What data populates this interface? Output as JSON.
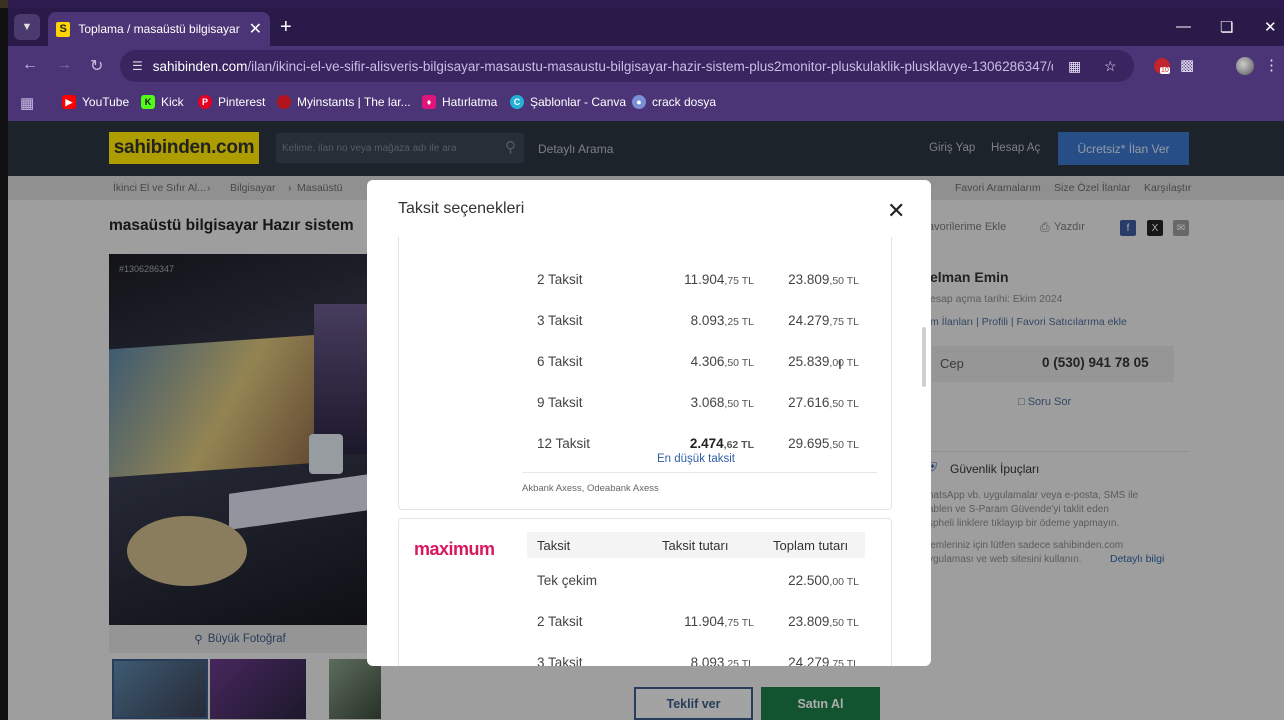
{
  "browser": {
    "tab_title": "Toplama / masaüstü bilgisayar",
    "url_host": "sahibinden.com",
    "url_path": "/ilan/ikinci-el-ve-sifir-alisveris-bilgisayar-masaustu-masaustu-bilgisayar-hazir-sistem-plus2monitor-pluskulaklik-plusklavye-1306286347/de...",
    "bookmarks": [
      {
        "label": "YouTube",
        "color": "#ff0000"
      },
      {
        "label": "Kick",
        "color": "#53fc18"
      },
      {
        "label": "Pinterest",
        "color": "#e60023"
      },
      {
        "label": "Myinstants | The lar...",
        "color": "#b0131c"
      },
      {
        "label": "Hatırlatma",
        "color": "#e0157a"
      },
      {
        "label": "Şablonlar - Canva",
        "color": "#22b1d6"
      },
      {
        "label": "crack dosya",
        "color": "#7a8fd6"
      }
    ],
    "ext_badge": "10"
  },
  "site": {
    "logo": "sahibinden.com",
    "search_placeholder": "Kelime, ilan no veya mağaza adı ile ara",
    "detailed_search": "Detaylı Arama",
    "login": "Giriş Yap",
    "register": "Hesap Aç",
    "post_ad": "Ücretsiz* İlan Ver",
    "breadcrumbs": [
      "İkinci El ve Sıfır Al...",
      "Bilgisayar",
      "Masaüstü"
    ],
    "right_links": [
      "Favori Aramalarım",
      "Size Özel İlanlar",
      "Karşılaştır"
    ],
    "page_title": "masaüstü bilgisayar Hazır sistem",
    "photo_id": "#1306286347",
    "big_photo": "Büyük Fotoğraf",
    "fav_label": "avorilerime Ekle",
    "print_label": "Yazdır",
    "seller_name": "elman Emin",
    "seller_since": "esap açma tarihi: Ekim 2024",
    "seller_links": "m İlanları  |  Profili  |  Favori Satıcılarıma ekle",
    "cep_label": "Cep",
    "cep_number": "0 (530) 941 78 05",
    "ask_label": "Soru Sor",
    "safety_title": "Güvenlik İpuçları",
    "safety_text1": "hatsApp vb. uygulamalar veya e-posta, SMS ile",
    "safety_text2": "ablen ve S-Param Güvende'yi taklit eden",
    "safety_text3": "şpheli linklere tıklayıp bir ödeme yapmayın.",
    "safety_text4": "lemleriniz için lütfen sadece sahibinden.com",
    "safety_text5": "ygulaması ve web sitesini kullanın.",
    "safety_link": "Detaylı bilgi",
    "offer_btn": "Teklif ver",
    "buy_btn": "Satın Al"
  },
  "modal": {
    "title": "Taksit seçenekleri",
    "card1": {
      "rows": [
        {
          "count": "2 Taksit",
          "amount_main": "11.904",
          "amount_dec": ",75 TL",
          "total_main": "23.809",
          "total_dec": ",50 TL"
        },
        {
          "count": "3 Taksit",
          "amount_main": "8.093",
          "amount_dec": ",25 TL",
          "total_main": "24.279",
          "total_dec": ",75 TL"
        },
        {
          "count": "6 Taksit",
          "amount_main": "4.306",
          "amount_dec": ",50 TL",
          "total_main": "25.839",
          "total_dec": ",00 TL"
        },
        {
          "count": "9 Taksit",
          "amount_main": "3.068",
          "amount_dec": ",50 TL",
          "total_main": "27.616",
          "total_dec": ",50 TL"
        },
        {
          "count": "12 Taksit",
          "amount_main": "2.474",
          "amount_dec": ",62 TL",
          "total_main": "29.695",
          "total_dec": ",50 TL"
        }
      ],
      "best_note": "En düşük taksit",
      "banks": "Akbank Axess, Odeabank Axess"
    },
    "card2": {
      "logo": "maximum",
      "headers": [
        "Taksit",
        "Taksit tutarı",
        "Toplam tutarı"
      ],
      "rows": [
        {
          "count": "Tek çekim",
          "amount_main": "",
          "amount_dec": "",
          "total_main": "22.500",
          "total_dec": ",00 TL"
        },
        {
          "count": "2 Taksit",
          "amount_main": "11.904",
          "amount_dec": ",75 TL",
          "total_main": "23.809",
          "total_dec": ",50 TL"
        },
        {
          "count": "3 Taksit",
          "amount_main": "8.093",
          "amount_dec": ",25 TL",
          "total_main": "24.279",
          "total_dec": ",75 TL"
        }
      ]
    }
  }
}
